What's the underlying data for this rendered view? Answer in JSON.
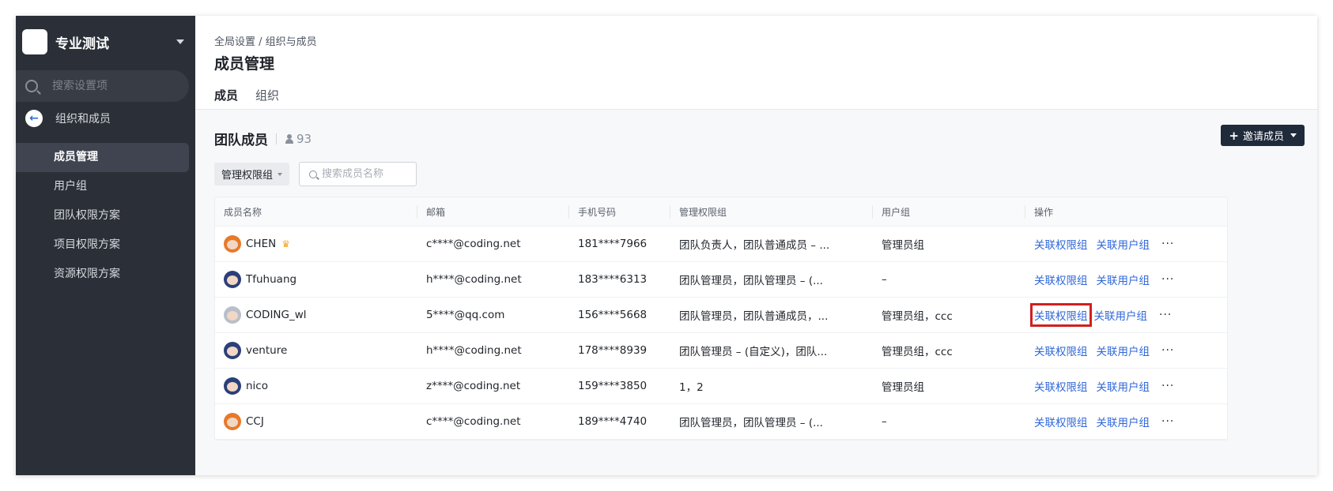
{
  "sidebar": {
    "team_name": "专业测试",
    "search_placeholder": "搜索设置项",
    "back_label": "组织和成员",
    "items": [
      {
        "label": "成员管理",
        "active": true
      },
      {
        "label": "用户组",
        "active": false
      },
      {
        "label": "团队权限方案",
        "active": false
      },
      {
        "label": "项目权限方案",
        "active": false
      },
      {
        "label": "资源权限方案",
        "active": false
      }
    ]
  },
  "header": {
    "breadcrumb": "全局设置 / 组织与成员",
    "title": "成员管理",
    "tabs": [
      {
        "label": "成员",
        "active": true
      },
      {
        "label": "组织",
        "active": false
      }
    ]
  },
  "members": {
    "title": "团队成员",
    "count": "93",
    "invite_label": "邀请成员",
    "filter_label": "管理权限组",
    "search_placeholder": "搜索成员名称",
    "columns": [
      "成员名称",
      "邮箱",
      "手机号码",
      "管理权限组",
      "用户组",
      "操作"
    ],
    "rows": [
      {
        "name": "CHEN",
        "email": "c****@coding.net",
        "phone": "181****7966",
        "admin_groups": "团队负责人，团队普通成员 – ...",
        "user_groups": "管理员组",
        "owner": true,
        "avatar_color": "#e8792b"
      },
      {
        "name": "Tfuhuang",
        "email": "h****@coding.net",
        "phone": "183****6313",
        "admin_groups": "团队管理员，团队管理员 – (...",
        "user_groups": "–",
        "owner": false,
        "avatar_color": "#2b3f7a"
      },
      {
        "name": "CODING_wl",
        "email": "5****@qq.com",
        "phone": "156****5668",
        "admin_groups": "团队管理员，团队普通成员，...",
        "user_groups": "管理员组，ccc",
        "owner": false,
        "avatar_color": "#b9bfca"
      },
      {
        "name": "venture",
        "email": "h****@coding.net",
        "phone": "178****8939",
        "admin_groups": "团队管理员 – (自定义)，团队...",
        "user_groups": "管理员组，ccc",
        "owner": false,
        "avatar_color": "#2b3f7a"
      },
      {
        "name": "nico",
        "email": "z****@coding.net",
        "phone": "159****3850",
        "admin_groups": "1，2",
        "user_groups": "管理员组",
        "owner": false,
        "avatar_color": "#2b3f7a"
      },
      {
        "name": "CCJ",
        "email": "c****@coding.net",
        "phone": "189****4740",
        "admin_groups": "团队管理员，团队管理员 – (...",
        "user_groups": "–",
        "owner": false,
        "avatar_color": "#e8792b"
      }
    ],
    "action_link_permission": "关联权限组",
    "action_link_usergroup": "关联用户组",
    "more_label": "···",
    "highlighted_row": 2
  },
  "colors": {
    "sidebar_bg": "#2b3038",
    "link": "#2f67d8",
    "highlight": "#d21f1f",
    "primary_btn": "#1f2a3a"
  }
}
